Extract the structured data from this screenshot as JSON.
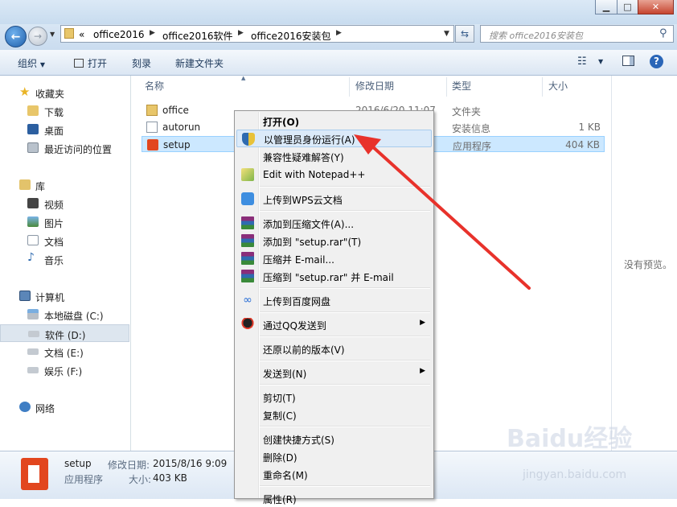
{
  "address_bar": {
    "prefix": "«",
    "crumbs": [
      "office2016",
      "office2016软件",
      "office2016安装包"
    ]
  },
  "search": {
    "placeholder": "搜索 office2016安装包"
  },
  "toolbar": {
    "organize": "组织",
    "open": "打开",
    "burn": "刻录",
    "new_folder": "新建文件夹"
  },
  "sidebar": {
    "favorites": {
      "title": "收藏夹",
      "items": [
        "下载",
        "桌面",
        "最近访问的位置"
      ]
    },
    "libraries": {
      "title": "库",
      "items": [
        "视频",
        "图片",
        "文档",
        "音乐"
      ]
    },
    "computer": {
      "title": "计算机",
      "items": [
        "本地磁盘 (C:)",
        "软件 (D:)",
        "文档 (E:)",
        "娱乐 (F:)"
      ]
    },
    "network": {
      "title": "网络"
    }
  },
  "columns": {
    "name": "名称",
    "date": "修改日期",
    "type": "类型",
    "size": "大小"
  },
  "files": [
    {
      "name": "office",
      "date": "2016/6/20 11:07",
      "type": "文件夹",
      "size": ""
    },
    {
      "name": "autorun",
      "date": "",
      "type": "安装信息",
      "size": "1 KB"
    },
    {
      "name": "setup",
      "date": "",
      "type": "应用程序",
      "size": "404 KB"
    }
  ],
  "preview": {
    "empty_text": "没有预览。"
  },
  "details": {
    "name": "setup",
    "type": "应用程序",
    "modified_label": "修改日期:",
    "modified_value": "2015/8/16 9:09",
    "size_label": "大小:",
    "size_value": "403 KB"
  },
  "context_menu": {
    "open": "打开(O)",
    "run_as_admin": "以管理员身份运行(A)",
    "troubleshoot": "兼容性疑难解答(Y)",
    "edit_notepad": "Edit with Notepad++",
    "upload_wps": "上传到WPS云文档",
    "add_archive": "添加到压缩文件(A)...",
    "add_setup_rar": "添加到 \"setup.rar\"(T)",
    "compress_email": "压缩并 E-mail...",
    "compress_setup_email": "压缩到 \"setup.rar\" 并 E-mail",
    "upload_baidu": "上传到百度网盘",
    "send_qq": "通过QQ发送到",
    "restore_versions": "还原以前的版本(V)",
    "send_to": "发送到(N)",
    "cut": "剪切(T)",
    "copy": "复制(C)",
    "create_shortcut": "创建快捷方式(S)",
    "delete": "删除(D)",
    "rename": "重命名(M)",
    "properties": "属性(R)"
  },
  "watermark": {
    "brand": "Baidu经验",
    "url": "jingyan.baidu.com"
  },
  "colors": {
    "accent_arrow": "#e8322b",
    "selection": "#cce8ff",
    "office_red": "#e2461e"
  }
}
